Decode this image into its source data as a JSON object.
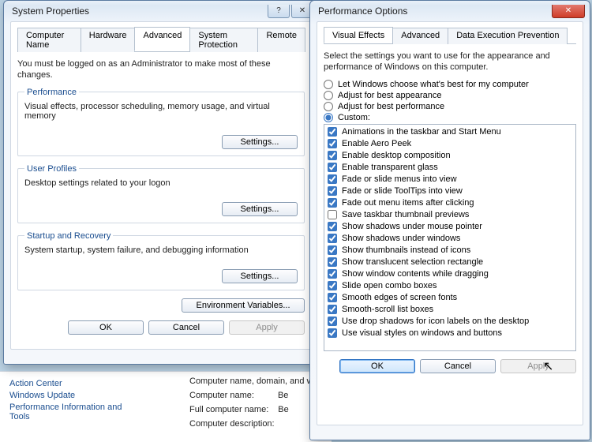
{
  "bg": {
    "nav": [
      "Action Center",
      "Windows Update",
      "Performance Information and Tools"
    ],
    "section_heading": "Computer name, domain, and wo",
    "labels": [
      "Computer name:",
      "Full computer name:",
      "Computer description:"
    ],
    "values": [
      "Be",
      "Be",
      ""
    ]
  },
  "sysProps": {
    "title": "System Properties",
    "tabs": [
      "Computer Name",
      "Hardware",
      "Advanced",
      "System Protection",
      "Remote"
    ],
    "activeTab": 2,
    "hint": "You must be logged on as an Administrator to make most of these changes.",
    "groups": [
      {
        "legend": "Performance",
        "desc": "Visual effects, processor scheduling, memory usage, and virtual memory",
        "button": "Settings..."
      },
      {
        "legend": "User Profiles",
        "desc": "Desktop settings related to your logon",
        "button": "Settings..."
      },
      {
        "legend": "Startup and Recovery",
        "desc": "System startup, system failure, and debugging information",
        "button": "Settings..."
      }
    ],
    "envVars": "Environment Variables...",
    "buttons": {
      "ok": "OK",
      "cancel": "Cancel",
      "apply": "Apply"
    }
  },
  "perfOpts": {
    "title": "Performance Options",
    "tabs": [
      "Visual Effects",
      "Advanced",
      "Data Execution Prevention"
    ],
    "activeTab": 0,
    "hint": "Select the settings you want to use for the appearance and performance of Windows on this computer.",
    "radios": [
      "Let Windows choose what's best for my computer",
      "Adjust for best appearance",
      "Adjust for best performance",
      "Custom:"
    ],
    "selectedRadio": 3,
    "effects": [
      {
        "checked": true,
        "label": "Animations in the taskbar and Start Menu"
      },
      {
        "checked": true,
        "label": "Enable Aero Peek"
      },
      {
        "checked": true,
        "label": "Enable desktop composition"
      },
      {
        "checked": true,
        "label": "Enable transparent glass"
      },
      {
        "checked": true,
        "label": "Fade or slide menus into view"
      },
      {
        "checked": true,
        "label": "Fade or slide ToolTips into view"
      },
      {
        "checked": true,
        "label": "Fade out menu items after clicking"
      },
      {
        "checked": false,
        "label": "Save taskbar thumbnail previews"
      },
      {
        "checked": true,
        "label": "Show shadows under mouse pointer"
      },
      {
        "checked": true,
        "label": "Show shadows under windows"
      },
      {
        "checked": true,
        "label": "Show thumbnails instead of icons"
      },
      {
        "checked": true,
        "label": "Show translucent selection rectangle"
      },
      {
        "checked": true,
        "label": "Show window contents while dragging"
      },
      {
        "checked": true,
        "label": "Slide open combo boxes"
      },
      {
        "checked": true,
        "label": "Smooth edges of screen fonts"
      },
      {
        "checked": true,
        "label": "Smooth-scroll list boxes"
      },
      {
        "checked": true,
        "label": "Use drop shadows for icon labels on the desktop"
      },
      {
        "checked": true,
        "label": "Use visual styles on windows and buttons"
      }
    ],
    "buttons": {
      "ok": "OK",
      "cancel": "Cancel",
      "apply": "Apply"
    }
  }
}
